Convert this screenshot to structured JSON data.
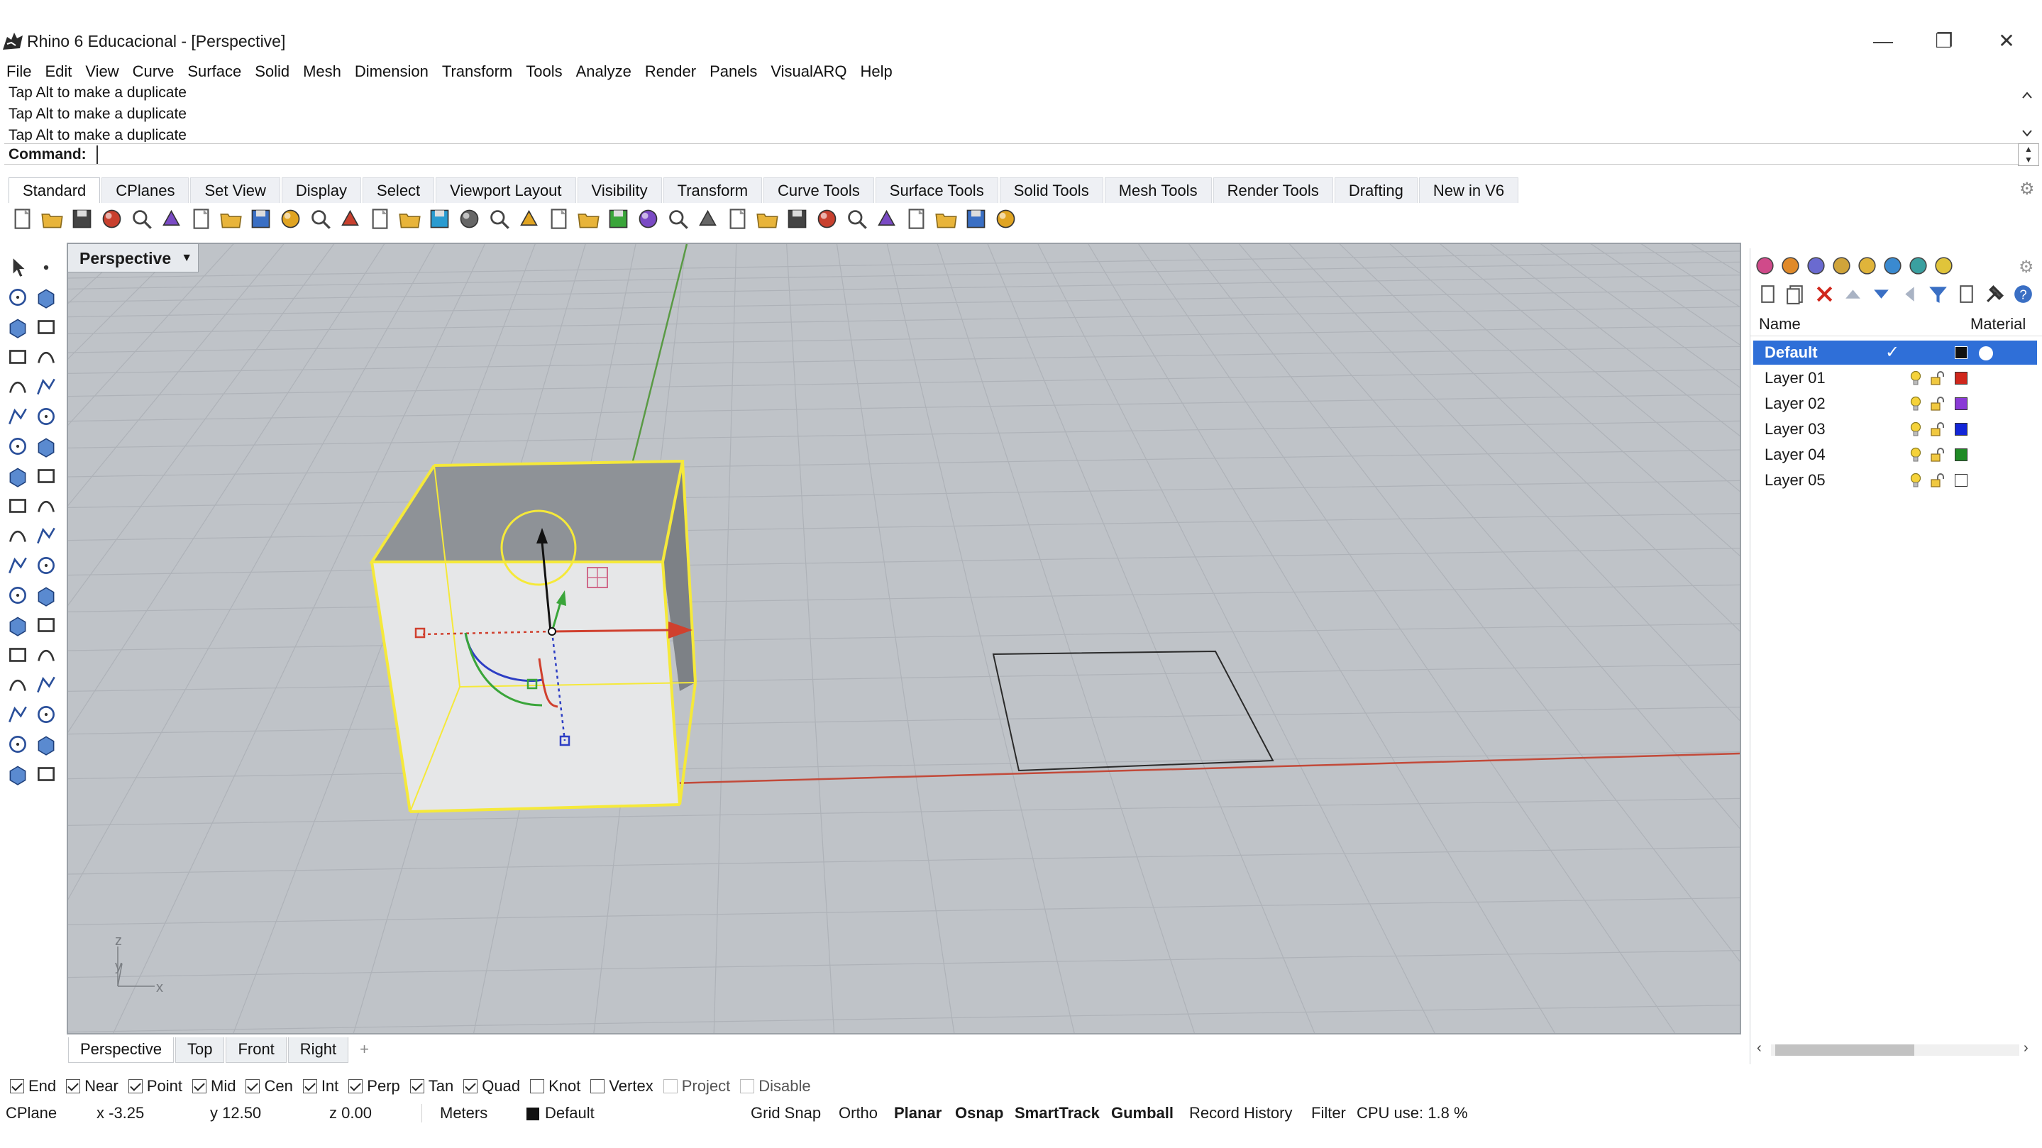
{
  "window": {
    "title": "Rhino 6 Educacional - [Perspective]",
    "minimize_glyph": "—",
    "restore_glyph": "❐",
    "close_glyph": "✕"
  },
  "menu": [
    "File",
    "Edit",
    "View",
    "Curve",
    "Surface",
    "Solid",
    "Mesh",
    "Dimension",
    "Transform",
    "Tools",
    "Analyze",
    "Render",
    "Panels",
    "VisualARQ",
    "Help"
  ],
  "command_history": [
    "Tap Alt to make a duplicate",
    "Tap Alt to make a duplicate",
    "Tap Alt to make a duplicate"
  ],
  "command": {
    "label": "Command:",
    "value": ""
  },
  "toolbar_tabs": [
    "Standard",
    "CPlanes",
    "Set View",
    "Display",
    "Select",
    "Viewport Layout",
    "Visibility",
    "Transform",
    "Curve Tools",
    "Surface Tools",
    "Solid Tools",
    "Mesh Tools",
    "Render Tools",
    "Drafting",
    "New in V6"
  ],
  "toolbar_tabs_active": 0,
  "standard_tools": [
    "new-file-icon",
    "open-file-icon",
    "save-icon",
    "print-icon",
    "export-icon",
    "cut-icon",
    "copy-icon",
    "paste-icon",
    "undo-icon",
    "pan-icon",
    "rotate-view-icon",
    "zoom-icon",
    "zoom-window-icon",
    "zoom-extents-icon",
    "zoom-selected-icon",
    "rotate-icon",
    "grid-icon",
    "toggle-icon",
    "properties-icon",
    "osnap-icon",
    "select-points-icon",
    "light-icon",
    "lock-icon",
    "shade-icon",
    "color-icon",
    "render-sphere-icon",
    "material-icon",
    "environment-icon",
    "dimension-icon",
    "gear-tools-icon",
    "flow-icon",
    "globe-icon",
    "help-icon",
    "more-icon"
  ],
  "viewport": {
    "title": "Perspective",
    "axis_labels": {
      "z": "z",
      "y": "y",
      "x": "x"
    }
  },
  "viewport_tabs": [
    "Perspective",
    "Top",
    "Front",
    "Right"
  ],
  "viewport_tabs_active": 0,
  "viewport_add": "+",
  "layers": {
    "header_name": "Name",
    "header_material": "Material",
    "rows": [
      {
        "name": "Default",
        "color": "#111111",
        "selected": true
      },
      {
        "name": "Layer 01",
        "color": "#d0271c",
        "selected": false
      },
      {
        "name": "Layer 02",
        "color": "#8a3ad6",
        "selected": false
      },
      {
        "name": "Layer 03",
        "color": "#1326d8",
        "selected": false
      },
      {
        "name": "Layer 04",
        "color": "#1f8a25",
        "selected": false
      },
      {
        "name": "Layer 05",
        "color": "#ffffff",
        "selected": false
      }
    ]
  },
  "osnaps": [
    {
      "label": "End",
      "checked": true,
      "enabled": true
    },
    {
      "label": "Near",
      "checked": true,
      "enabled": true
    },
    {
      "label": "Point",
      "checked": true,
      "enabled": true
    },
    {
      "label": "Mid",
      "checked": true,
      "enabled": true
    },
    {
      "label": "Cen",
      "checked": true,
      "enabled": true
    },
    {
      "label": "Int",
      "checked": true,
      "enabled": true
    },
    {
      "label": "Perp",
      "checked": true,
      "enabled": true
    },
    {
      "label": "Tan",
      "checked": true,
      "enabled": true
    },
    {
      "label": "Quad",
      "checked": true,
      "enabled": true
    },
    {
      "label": "Knot",
      "checked": false,
      "enabled": true
    },
    {
      "label": "Vertex",
      "checked": false,
      "enabled": true
    },
    {
      "label": "Project",
      "checked": false,
      "enabled": false
    },
    {
      "label": "Disable",
      "checked": false,
      "enabled": false
    }
  ],
  "status": {
    "cplane": "CPlane",
    "x": "x -3.25",
    "y": "y 12.50",
    "z": "z 0.00",
    "units": "Meters",
    "layer": "Default",
    "grid_snap": "Grid Snap",
    "ortho": "Ortho",
    "planar": "Planar",
    "osnap": "Osnap",
    "smarttrack": "SmartTrack",
    "gumball": "Gumball",
    "record_history": "Record History",
    "filter": "Filter",
    "cpu": "CPU use: 1.8 %"
  },
  "colors": {
    "viewport_bg": "#bfc3c8",
    "selection_yellow": "#f5e93a",
    "x_axis": "#c84a3a",
    "y_axis": "#4a9a3a",
    "layer_selected": "#2f6fd8"
  }
}
